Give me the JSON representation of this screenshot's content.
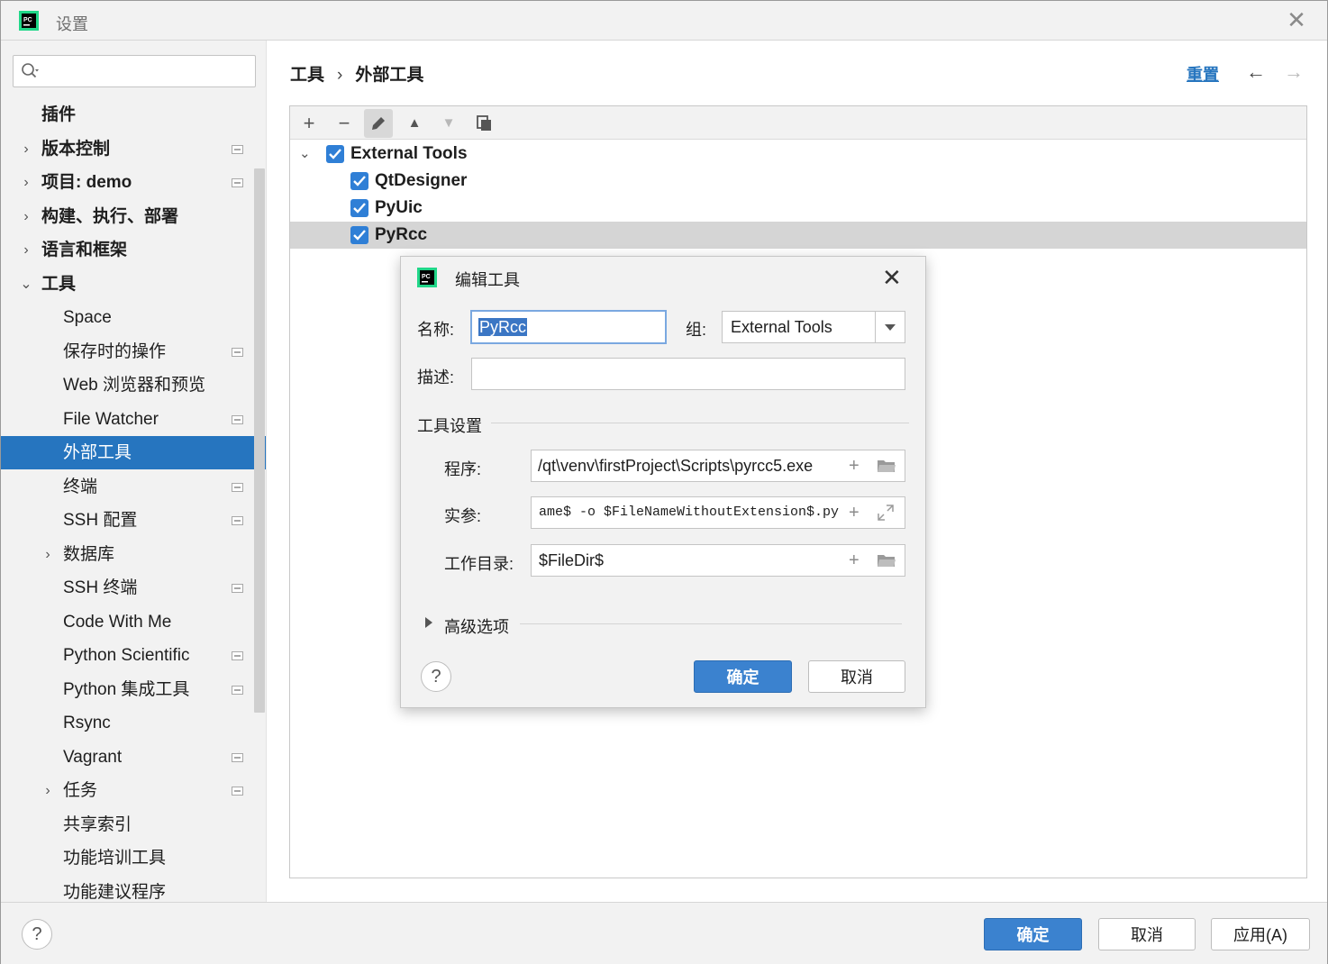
{
  "window": {
    "title": "设置",
    "close_symbol": "✕"
  },
  "search": {
    "placeholder": "",
    "value": ""
  },
  "sidebar": {
    "items": [
      {
        "label": "插件",
        "level": 0,
        "bold": true,
        "chevron": "",
        "proj": false
      },
      {
        "label": "版本控制",
        "level": 0,
        "bold": true,
        "chevron": "›",
        "proj": true
      },
      {
        "label": "项目: demo",
        "level": 0,
        "bold": true,
        "chevron": "›",
        "proj": true
      },
      {
        "label": "构建、执行、部署",
        "level": 0,
        "bold": true,
        "chevron": "›",
        "proj": false
      },
      {
        "label": "语言和框架",
        "level": 0,
        "bold": true,
        "chevron": "›",
        "proj": false
      },
      {
        "label": "工具",
        "level": 0,
        "bold": true,
        "chevron": "⌄",
        "proj": false
      },
      {
        "label": "Space",
        "level": 1,
        "bold": false,
        "chevron": "",
        "proj": false
      },
      {
        "label": "保存时的操作",
        "level": 1,
        "bold": false,
        "chevron": "",
        "proj": true
      },
      {
        "label": "Web 浏览器和预览",
        "level": 1,
        "bold": false,
        "chevron": "",
        "proj": false
      },
      {
        "label": "File Watcher",
        "level": 1,
        "bold": false,
        "chevron": "",
        "proj": true
      },
      {
        "label": "外部工具",
        "level": 1,
        "bold": false,
        "chevron": "",
        "proj": false,
        "selected": true
      },
      {
        "label": "终端",
        "level": 1,
        "bold": false,
        "chevron": "",
        "proj": true
      },
      {
        "label": "SSH 配置",
        "level": 1,
        "bold": false,
        "chevron": "",
        "proj": true
      },
      {
        "label": "数据库",
        "level": 1,
        "bold": false,
        "chevron": "›",
        "proj": false
      },
      {
        "label": "SSH 终端",
        "level": 1,
        "bold": false,
        "chevron": "",
        "proj": true
      },
      {
        "label": "Code With Me",
        "level": 1,
        "bold": false,
        "chevron": "",
        "proj": false
      },
      {
        "label": "Python Scientific",
        "level": 1,
        "bold": false,
        "chevron": "",
        "proj": true
      },
      {
        "label": "Python 集成工具",
        "level": 1,
        "bold": false,
        "chevron": "",
        "proj": true
      },
      {
        "label": "Rsync",
        "level": 1,
        "bold": false,
        "chevron": "",
        "proj": false
      },
      {
        "label": "Vagrant",
        "level": 1,
        "bold": false,
        "chevron": "",
        "proj": true
      },
      {
        "label": "任务",
        "level": 1,
        "bold": false,
        "chevron": "›",
        "proj": true
      },
      {
        "label": "共享索引",
        "level": 1,
        "bold": false,
        "chevron": "",
        "proj": false
      },
      {
        "label": "功能培训工具",
        "level": 1,
        "bold": false,
        "chevron": "",
        "proj": false
      },
      {
        "label": "功能建议程序",
        "level": 1,
        "bold": false,
        "chevron": "",
        "proj": false
      }
    ]
  },
  "header": {
    "breadcrumb": [
      "工具",
      "外部工具"
    ],
    "breadcrumb_sep": "›",
    "reset_label": "重置",
    "back_symbol": "←",
    "forward_symbol": "→"
  },
  "toolbar": {
    "add": "+",
    "remove": "−",
    "up": "▲",
    "down": "▼"
  },
  "tree": {
    "group": {
      "label": "External Tools",
      "checked": true
    },
    "items": [
      {
        "label": "QtDesigner",
        "checked": true
      },
      {
        "label": "PyUic",
        "checked": true
      },
      {
        "label": "PyRcc",
        "checked": true,
        "selected": true
      }
    ]
  },
  "dialog": {
    "title": "编辑工具",
    "close_symbol": "✕",
    "name_label": "名称:",
    "name_value": "PyRcc",
    "group_label": "组:",
    "group_value": "External Tools",
    "desc_label": "描述:",
    "desc_value": "",
    "tool_settings_label": "工具设置",
    "program_label": "程序:",
    "program_value": "/qt\\venv\\firstProject\\Scripts\\pyrcc5.exe",
    "args_label": "实参:",
    "args_value": "ame$ -o $FileNameWithoutExtension$.py",
    "workdir_label": "工作目录:",
    "workdir_value": "$FileDir$",
    "advanced_label": "高级选项",
    "ok_label": "确定",
    "cancel_label": "取消",
    "help_symbol": "?",
    "plus_symbol": "+"
  },
  "footer": {
    "help_symbol": "?",
    "ok_label": "确定",
    "cancel_label": "取消",
    "apply_label": "应用(A)"
  },
  "colors": {
    "accent": "#2675bf",
    "selection": "#2675bf",
    "checkbox": "#2f7fd6"
  }
}
